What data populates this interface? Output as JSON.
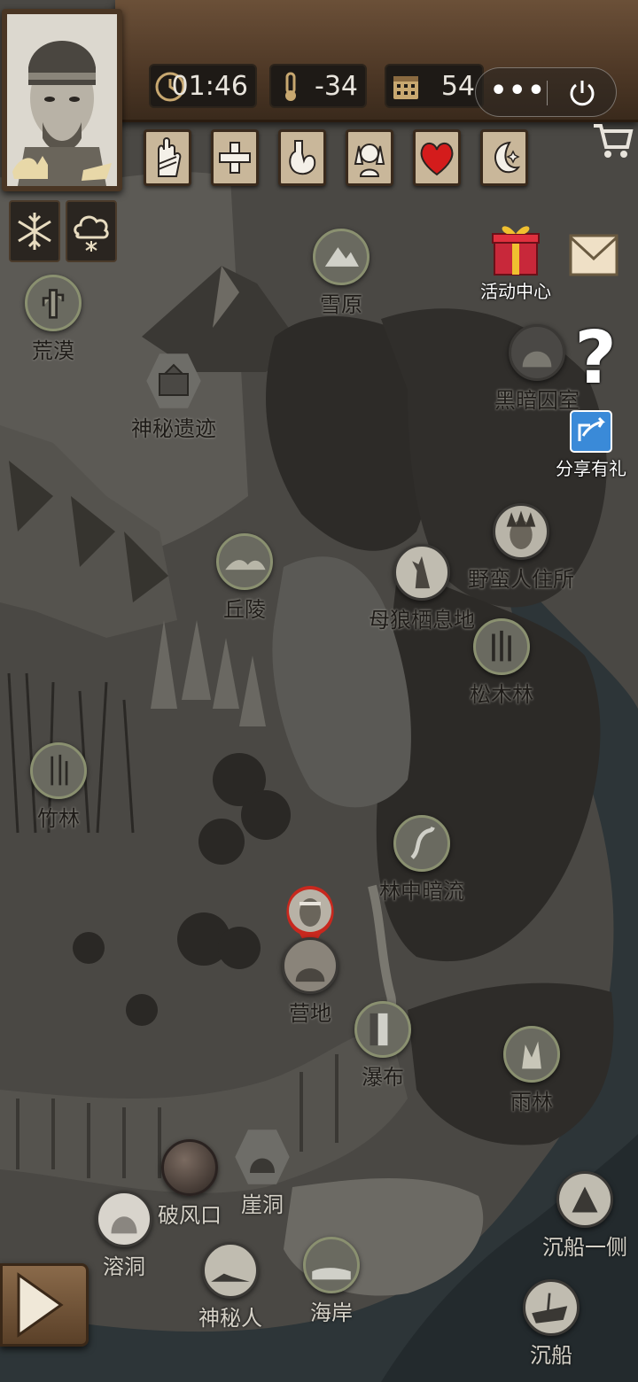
{
  "header": {
    "time": "01:46",
    "temperature": "-34",
    "day": "54",
    "more_label": "•••"
  },
  "status_icons": [
    "bandage-icon",
    "first-aid-icon",
    "stomach-icon",
    "headache-icon",
    "heart-icon",
    "night-moon-icon"
  ],
  "weather_icons": [
    "snowflake-icon",
    "snow-cloud-icon"
  ],
  "side": {
    "events_label": "活动中心",
    "share_label": "分享有礼",
    "help_label": "?"
  },
  "locations": {
    "snowfield": "雪原",
    "desert": "荒漠",
    "mystery_ruins": "神秘遗迹",
    "dark_cave": "黑暗囚室",
    "savage_dwelling": "野蛮人住所",
    "hills": "丘陵",
    "wolf_den": "母狼栖息地",
    "pine_forest": "松木林",
    "bamboo": "竹林",
    "forest_stream": "林中暗流",
    "camp": "营地",
    "waterfall": "瀑布",
    "rainforest": "雨林",
    "broken_wind": "破风口",
    "cliff_cave": "崖洞",
    "karst_cave": "溶洞",
    "mysterious_man": "神秘人",
    "coast": "海岸",
    "shipwreck_side": "沉船一侧",
    "shipwreck": "沉船"
  },
  "colors": {
    "accent_red": "#c8281e",
    "map_bg": "#3a3835",
    "wood": "#5a4028",
    "share_blue": "#3a8ad8"
  }
}
